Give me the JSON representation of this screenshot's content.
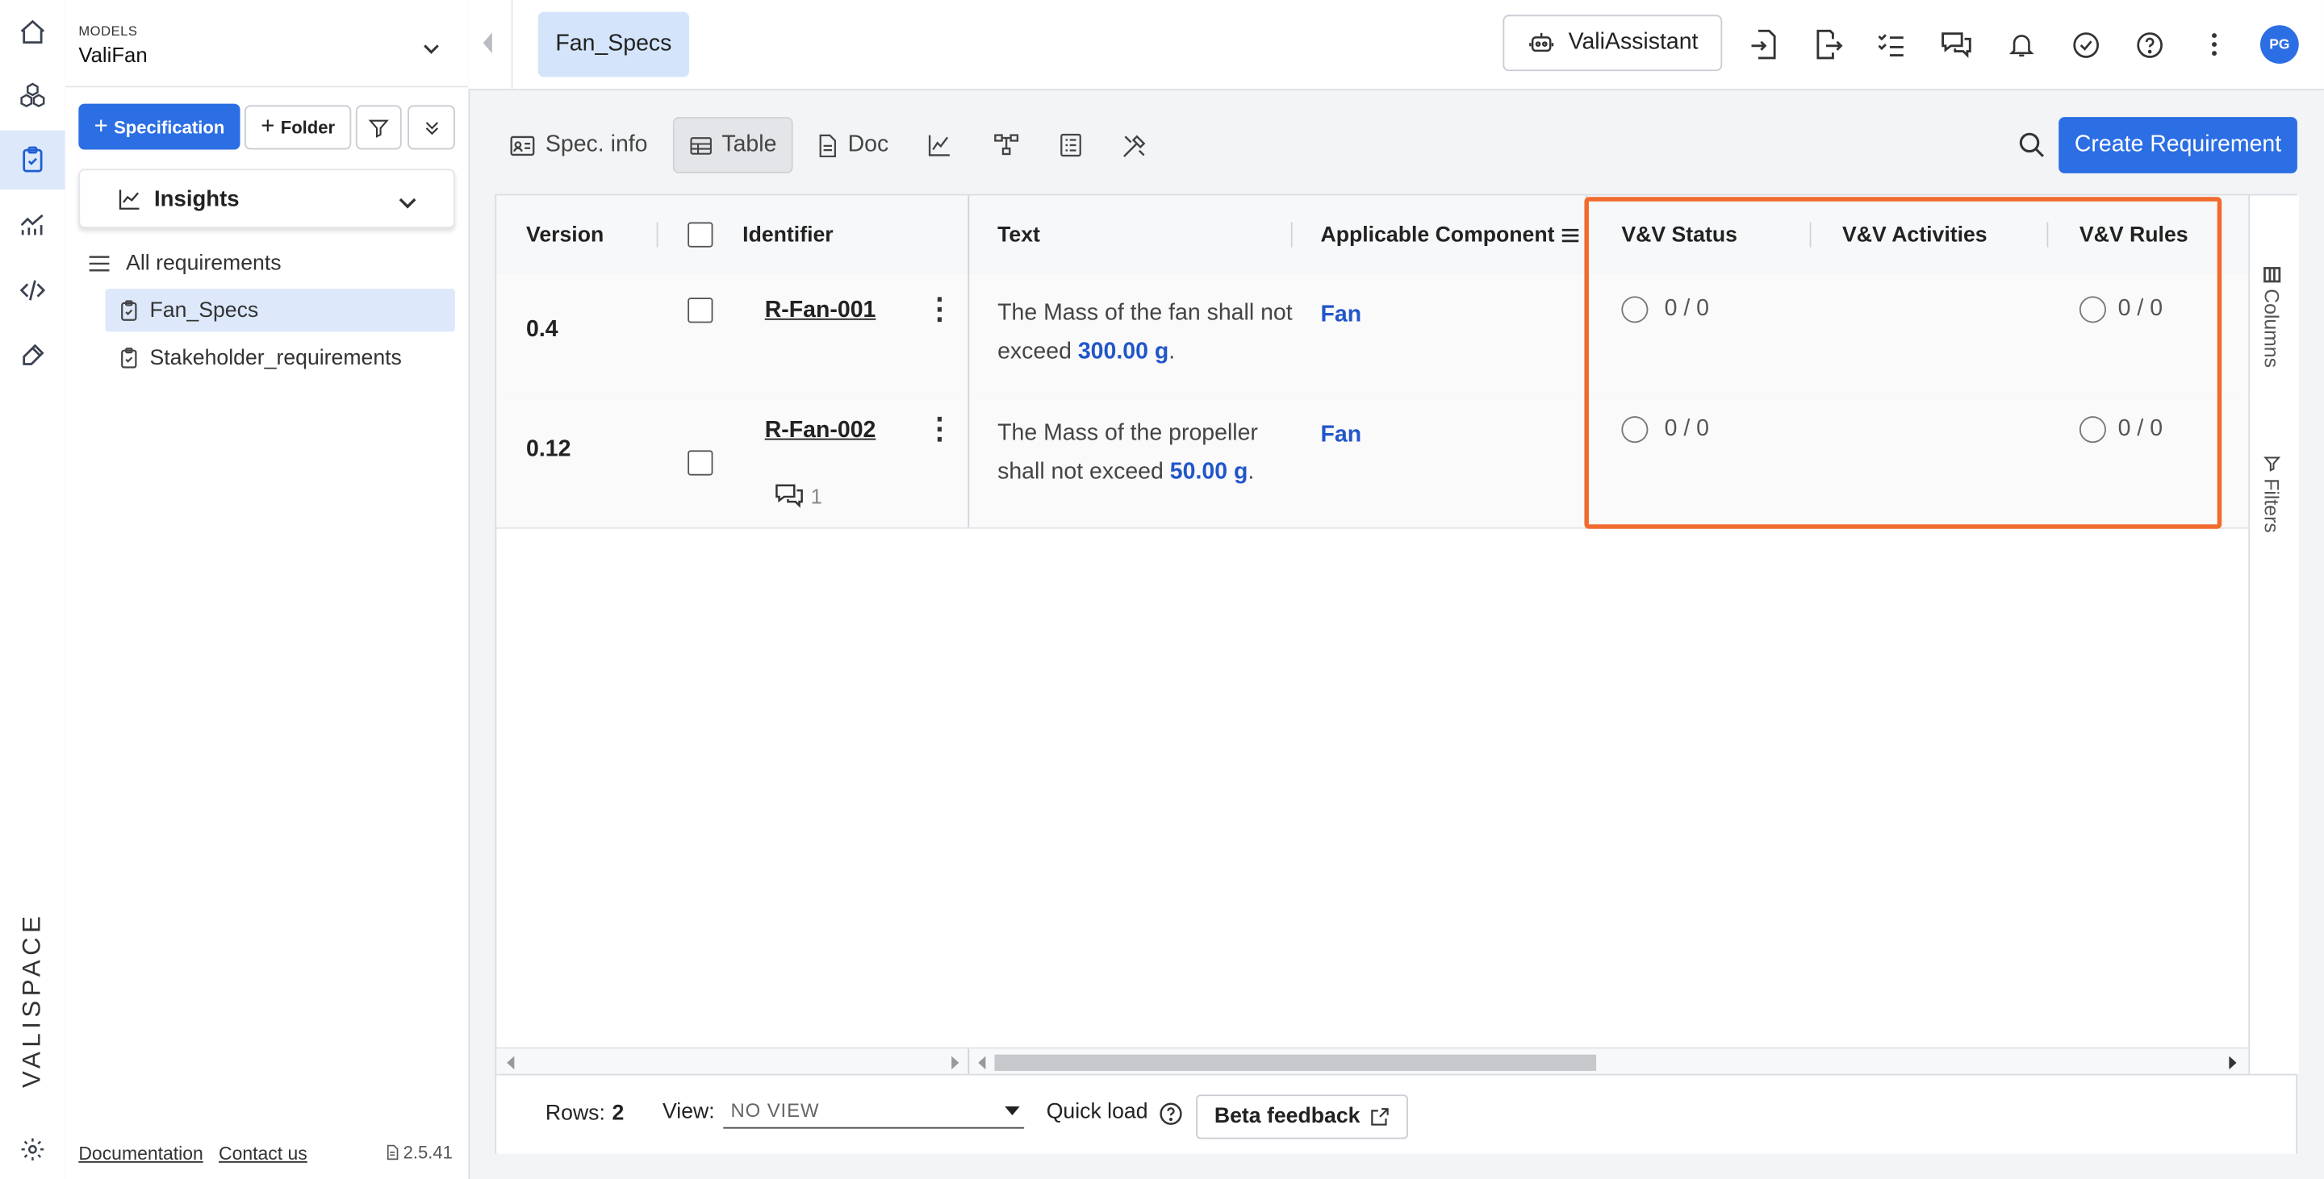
{
  "brand": {
    "logo_text": "VALISPACE"
  },
  "rail": {
    "items": [
      "home-icon",
      "cubes-icon",
      "clipboard-check-icon",
      "analytics-icon",
      "code-icon",
      "wrench-icon",
      "gear-icon"
    ],
    "active": "clipboard-check-icon"
  },
  "sidebar": {
    "models_label": "MODELS",
    "model_name": "ValiFan",
    "specification_button": "Specification",
    "folder_button": "Folder",
    "insights_label": "Insights",
    "tree": {
      "all": "All requirements",
      "items": [
        "Fan_Specs",
        "Stakeholder_requirements"
      ],
      "selected": "Fan_Specs"
    },
    "footer": {
      "documentation": "Documentation",
      "contact": "Contact us",
      "version": "2.5.41"
    }
  },
  "topbar": {
    "active_tab": "Fan_Specs",
    "assistant_label": "ValiAssistant",
    "avatar_initials": "PG"
  },
  "toolbar": {
    "spec_info": "Spec. info",
    "table": "Table",
    "doc": "Doc",
    "active": "Table",
    "create_button": "Create Requirement"
  },
  "table": {
    "columns": {
      "version": "Version",
      "identifier": "Identifier",
      "text": "Text",
      "component": "Applicable Component",
      "vv_status": "V&V Status",
      "vv_activities": "V&V Activities",
      "vv_rules": "V&V Rules"
    },
    "rows": [
      {
        "version": "0.4",
        "identifier": "R-Fan-001",
        "text_a": "The Mass of the fan shall not exceed",
        "value": "300.00",
        "unit": "g",
        "text_end": ".",
        "component": "Fan",
        "vv_status": "0 / 0",
        "vv_rules": "0 / 0",
        "comments": ""
      },
      {
        "version": "0.12",
        "identifier": "R-Fan-002",
        "text_a": "The Mass of the propeller shall not exceed",
        "value": "50.00",
        "unit": "g",
        "text_end": ".",
        "component": "Fan",
        "vv_status": "0 / 0",
        "vv_rules": "0 / 0",
        "comments": "1"
      }
    ],
    "side_tabs": {
      "columns": "Columns",
      "filters": "Filters"
    },
    "highlight_color": "#f06b2d"
  },
  "footer": {
    "rows_label": "Rows:",
    "rows_count": "2",
    "view_label": "View:",
    "view_value": "NO VIEW",
    "quick_load": "Quick load",
    "beta_feedback": "Beta feedback"
  },
  "colors": {
    "accent": "#2c6ee3",
    "link": "#2156c9",
    "selected": "#dde9fb"
  }
}
